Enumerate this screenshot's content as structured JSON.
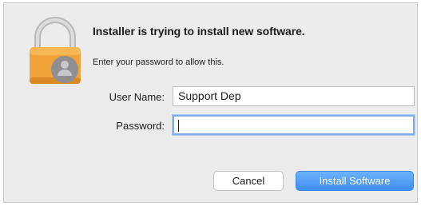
{
  "dialog": {
    "title": "Installer is trying to install new software.",
    "message": "Enter your password to allow this.",
    "username_label": "User Name:",
    "username_value": "Support Dep",
    "password_label": "Password:",
    "password_value": "",
    "cancel_label": "Cancel",
    "install_label": "Install Software",
    "icon": "padlock-icon",
    "accent_color": "#3d8ef2"
  }
}
